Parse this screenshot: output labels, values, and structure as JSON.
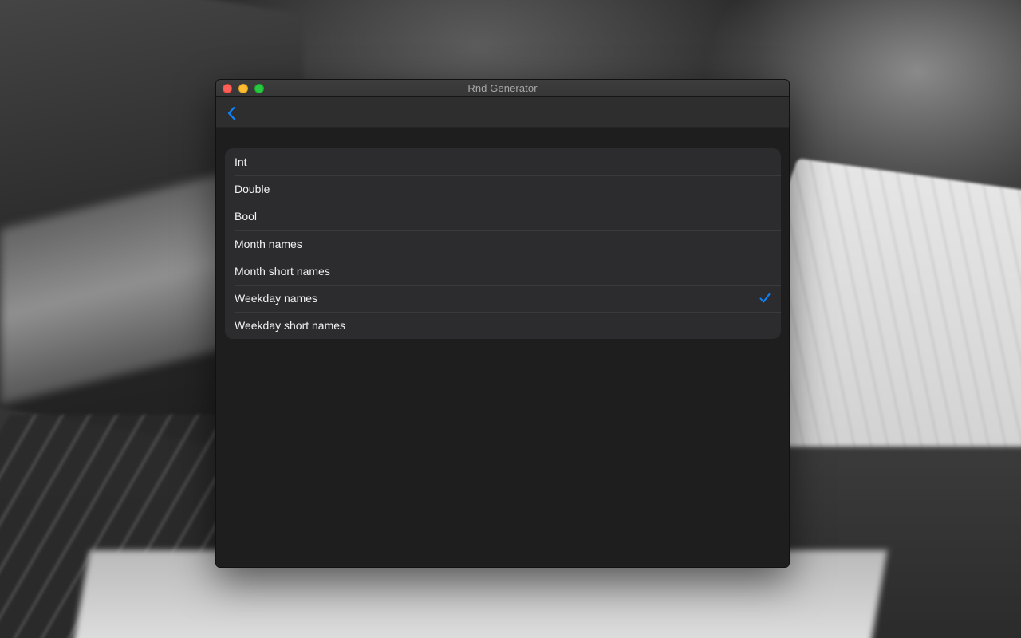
{
  "window": {
    "title": "Rnd Generator"
  },
  "navbar": {
    "back_icon": "chevron-left-icon"
  },
  "list": {
    "items": [
      {
        "label": "Int",
        "selected": false
      },
      {
        "label": "Double",
        "selected": false
      },
      {
        "label": "Bool",
        "selected": false
      },
      {
        "label": "Month names",
        "selected": false
      },
      {
        "label": "Month short names",
        "selected": false
      },
      {
        "label": "Weekday names",
        "selected": true
      },
      {
        "label": "Weekday short names",
        "selected": false
      }
    ],
    "selected_icon": "checkmark-icon"
  },
  "colors": {
    "accent": "#0a84ff",
    "window_background": "#1e1e1e",
    "list_background": "#2c2c2e",
    "traffic_close": "#ff5f57",
    "traffic_minimize": "#febc2e",
    "traffic_maximize": "#28c840"
  }
}
